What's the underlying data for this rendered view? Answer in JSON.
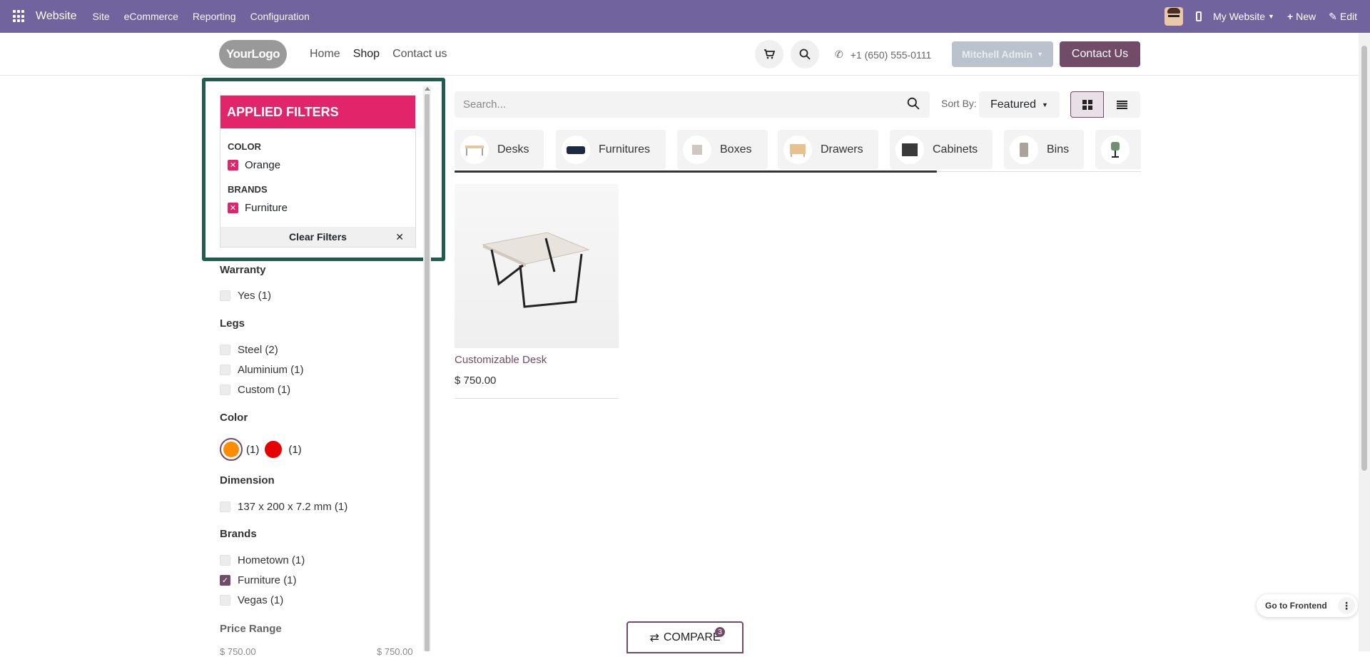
{
  "topbar": {
    "brand": "Website",
    "menus": [
      "Site",
      "eCommerce",
      "Reporting",
      "Configuration"
    ],
    "my_website": "My Website",
    "new_label": "New",
    "edit_label": "Edit"
  },
  "header": {
    "logo_text": "YourLogo",
    "nav": [
      "Home",
      "Shop",
      "Contact us"
    ],
    "phone": "+1 (650) 555-0111",
    "user": "Mitchell Admin",
    "contact_button": "Contact Us"
  },
  "applied_filters": {
    "title": "APPLIED FILTERS",
    "groups": [
      {
        "label": "COLOR",
        "value": "Orange"
      },
      {
        "label": "BRANDS",
        "value": "Furniture"
      }
    ],
    "clear_label": "Clear Filters"
  },
  "facets": {
    "warranty": {
      "title": "Warranty",
      "options": [
        "Yes (1)"
      ]
    },
    "legs": {
      "title": "Legs",
      "options": [
        "Steel (2)",
        "Aluminium (1)",
        "Custom (1)"
      ]
    },
    "color": {
      "title": "Color",
      "swatches": [
        {
          "color": "#ff8c00",
          "count": "(1)",
          "selected": true
        },
        {
          "color": "#e60000",
          "count": "(1)",
          "selected": false
        }
      ]
    },
    "dimension": {
      "title": "Dimension",
      "options": [
        "137 x 200 x 7.2 mm (1)"
      ]
    },
    "brands": {
      "title": "Brands",
      "options": [
        "Hometown (1)",
        "Furniture (1)",
        "Vegas (1)"
      ],
      "checked": [
        false,
        true,
        false
      ]
    },
    "price": {
      "title": "Price Range",
      "min": "$ 750.00",
      "max": "$ 750.00"
    }
  },
  "toolbar": {
    "search_placeholder": "Search...",
    "sort_label": "Sort By:",
    "sort_value": "Featured"
  },
  "categories": [
    "Desks",
    "Furnitures",
    "Boxes",
    "Drawers",
    "Cabinets",
    "Bins"
  ],
  "product": {
    "name": "Customizable Desk",
    "price": "$ 750.00"
  },
  "compare": {
    "label": "COMPARE",
    "count": "3"
  },
  "frontend_button": "Go to Frontend"
}
